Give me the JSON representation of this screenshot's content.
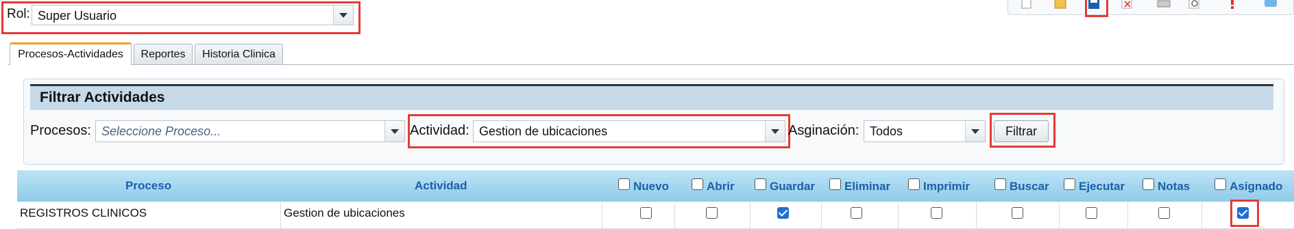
{
  "role": {
    "label": "Rol:",
    "value": "Super Usuario"
  },
  "tabs": [
    {
      "label": "Procesos-Actividades",
      "active": true
    },
    {
      "label": "Reportes",
      "active": false
    },
    {
      "label": "Historia Clinica",
      "active": false
    }
  ],
  "filter": {
    "title": "Filtrar Actividades",
    "procesos_label": "Procesos:",
    "procesos_placeholder": "Seleccione Proceso...",
    "actividad_label": "Actividad:",
    "actividad_value": "Gestion de ubicaciones",
    "asignacion_label": "Asginación:",
    "asignacion_value": "Todos",
    "filter_button": "Filtrar"
  },
  "table": {
    "col_proceso": "Proceso",
    "col_actividad": "Actividad",
    "perm_columns": [
      "Nuevo",
      "Abrir",
      "Guardar",
      "Eliminar",
      "Imprimir",
      "Buscar",
      "Ejecutar",
      "Notas",
      "Asignado"
    ],
    "rows": [
      {
        "proceso": "REGISTROS CLINICOS",
        "actividad": "Gestion de ubicaciones",
        "checks": [
          false,
          false,
          true,
          false,
          false,
          false,
          false,
          false,
          true
        ]
      }
    ]
  },
  "toolbar_icons": [
    "new-icon",
    "open-folder-icon",
    "save-icon",
    "delete-icon",
    "print-icon",
    "search-icon",
    "alert-icon",
    "notes-icon"
  ],
  "colors": {
    "accent": "#1a5fa8",
    "highlight": "#e53935",
    "header_bg": "#a9d4ee",
    "checked": "#1f6fd1"
  }
}
